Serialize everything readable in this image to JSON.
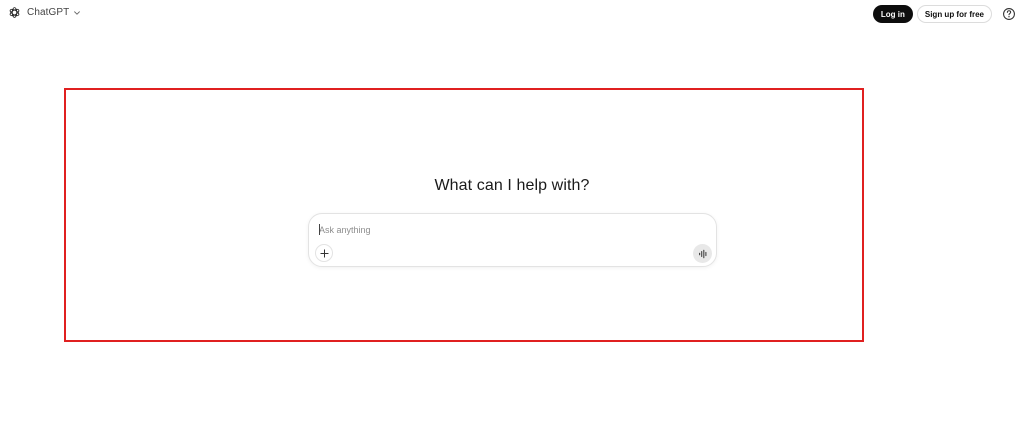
{
  "header": {
    "brand_name": "ChatGPT",
    "login_label": "Log in",
    "signup_label": "Sign up for free"
  },
  "hero": {
    "title": "What can I help with?"
  },
  "composer": {
    "placeholder": "Ask anything",
    "value": ""
  },
  "icons": {
    "brand": "openai-logo-icon",
    "model_menu": "chevron-down-icon",
    "help": "question-circle-icon",
    "attach": "plus-icon",
    "voice": "voice-waveform-icon"
  },
  "colors": {
    "primary_button": "#0d0d0d",
    "highlight_frame": "#e02020",
    "voice_button_bg": "#e8e8e8"
  }
}
